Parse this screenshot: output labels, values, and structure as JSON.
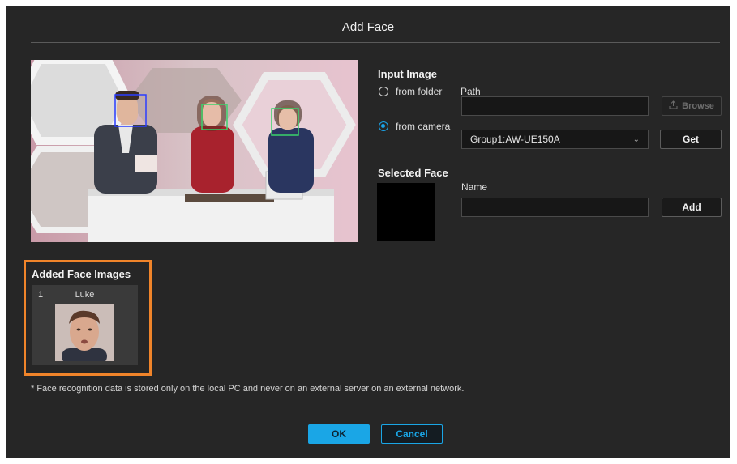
{
  "dialog": {
    "title": "Add Face"
  },
  "input_image": {
    "heading": "Input Image",
    "from_folder_label": "from folder",
    "from_camera_label": "from camera",
    "selected_source": "from camera",
    "path_label": "Path",
    "path_value": "",
    "browse_label": "Browse",
    "camera_value": "Group1:AW-UE150A",
    "get_label": "Get"
  },
  "selected_face": {
    "heading": "Selected Face",
    "name_label": "Name",
    "name_value": "",
    "add_label": "Add"
  },
  "added_faces": {
    "heading": "Added Face Images",
    "items": [
      {
        "index": "1",
        "name": "Luke"
      }
    ]
  },
  "preview": {
    "detections": [
      {
        "color": "#2a3cff"
      },
      {
        "color": "#3bd36b"
      },
      {
        "color": "#3bd36b"
      }
    ]
  },
  "note": "* Face recognition data is stored only on the local PC and never on an external server on an external network.",
  "footer": {
    "ok_label": "OK",
    "cancel_label": "Cancel"
  },
  "colors": {
    "accent": "#1aa6e6",
    "highlight": "#f0842a",
    "panel": "#262626"
  },
  "icons": {
    "browse": "upload-icon",
    "dropdown": "chevron-down-icon"
  }
}
